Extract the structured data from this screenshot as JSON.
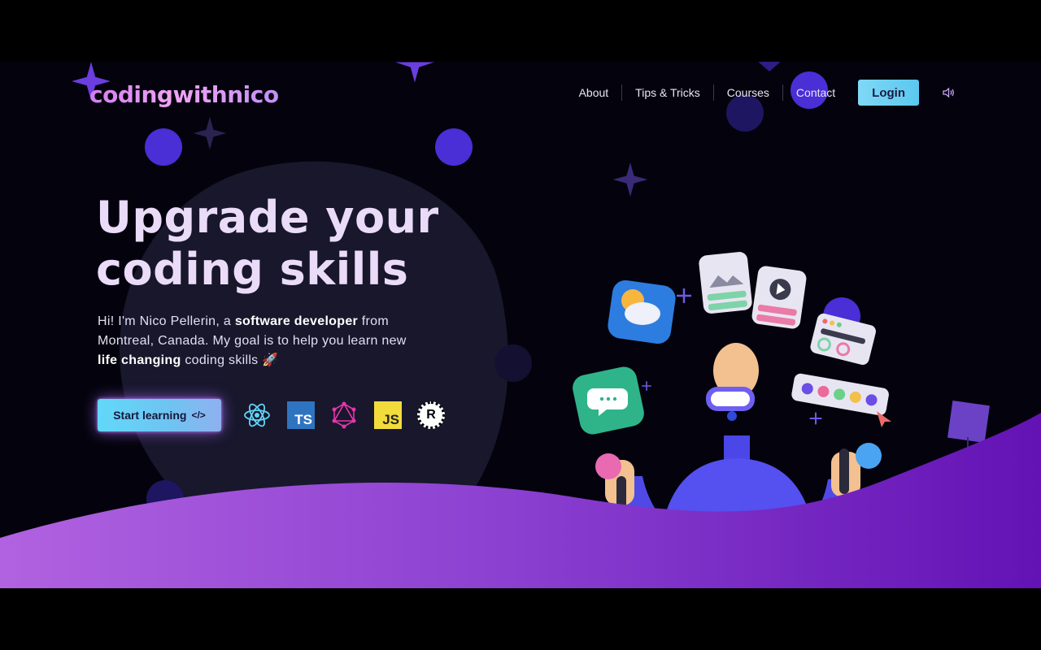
{
  "logo": {
    "text": "codingwithnico"
  },
  "nav": {
    "items": [
      {
        "label": "About"
      },
      {
        "label": "Tips & Tricks"
      },
      {
        "label": "Courses"
      },
      {
        "label": "Contact"
      }
    ],
    "login_label": "Login"
  },
  "hero": {
    "title": "Upgrade your\ncoding skills",
    "desc_1": "Hi! I'm Nico Pellerin, a ",
    "desc_bold_1": "software developer",
    "desc_2": " from Montreal, Canada. My goal is to help you learn new ",
    "desc_bold_2": "life changing",
    "desc_3": " coding skills 🚀",
    "cta_label": "Start learning",
    "cta_icon": "</>"
  },
  "tech_icons": [
    {
      "name": "react-icon"
    },
    {
      "name": "typescript-icon",
      "text": "TS"
    },
    {
      "name": "graphql-icon"
    },
    {
      "name": "javascript-icon",
      "text": "JS"
    },
    {
      "name": "rust-icon",
      "text": "R"
    }
  ],
  "colors": {
    "background": "#04030d",
    "accent_purple": "#4b2fd6",
    "wave_start": "#b062e0",
    "wave_end": "#6312b4",
    "cta_cyan": "#62d8f8"
  }
}
